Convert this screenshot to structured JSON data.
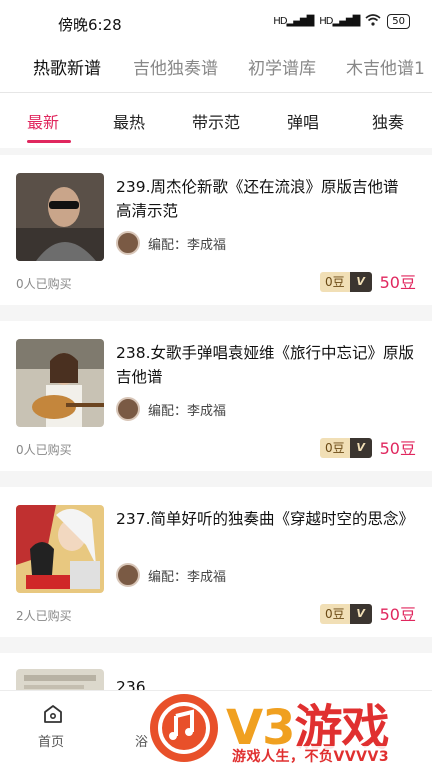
{
  "status": {
    "time": "傍晚6:28",
    "battery": "50"
  },
  "top_tabs": [
    "热歌新谱",
    "吉他独奏谱",
    "初学谱库",
    "木吉他谱1"
  ],
  "sub_tabs": [
    "最新",
    "最热",
    "带示范",
    "弹唱",
    "独奏"
  ],
  "cards": [
    {
      "title": "239.周杰伦新歌《还在流浪》原版吉他谱 高清示范",
      "author": "编配：李成福",
      "sold": "0人已购买",
      "pill_left": "0豆",
      "pill_right": "V",
      "price": "50豆"
    },
    {
      "title": "238.女歌手弹唱袁娅维《旅行中忘记》原版吉他谱",
      "author": "编配：李成福",
      "sold": "0人已购买",
      "pill_left": "0豆",
      "pill_right": "V",
      "price": "50豆"
    },
    {
      "title": "237.简单好听的独奏曲《穿越时空的思念》",
      "author": "编配：李成福",
      "sold": "2人已购买",
      "pill_left": "0豆",
      "pill_right": "V",
      "price": "50豆"
    },
    {
      "title": "236.",
      "author": "",
      "sold": "",
      "pill_left": "",
      "pill_right": "",
      "price": ""
    }
  ],
  "bottom_nav": {
    "home": "首页",
    "partial": "浴"
  },
  "watermark": {
    "brand_v": "V3",
    "brand_text": "游戏",
    "tagline": "游戏人生，不负VVVV3"
  },
  "colors": {
    "accent": "#e0275e",
    "pill_bg": "#f1dfb6",
    "watermark_orange": "#f0a020",
    "watermark_red": "#e03030"
  }
}
